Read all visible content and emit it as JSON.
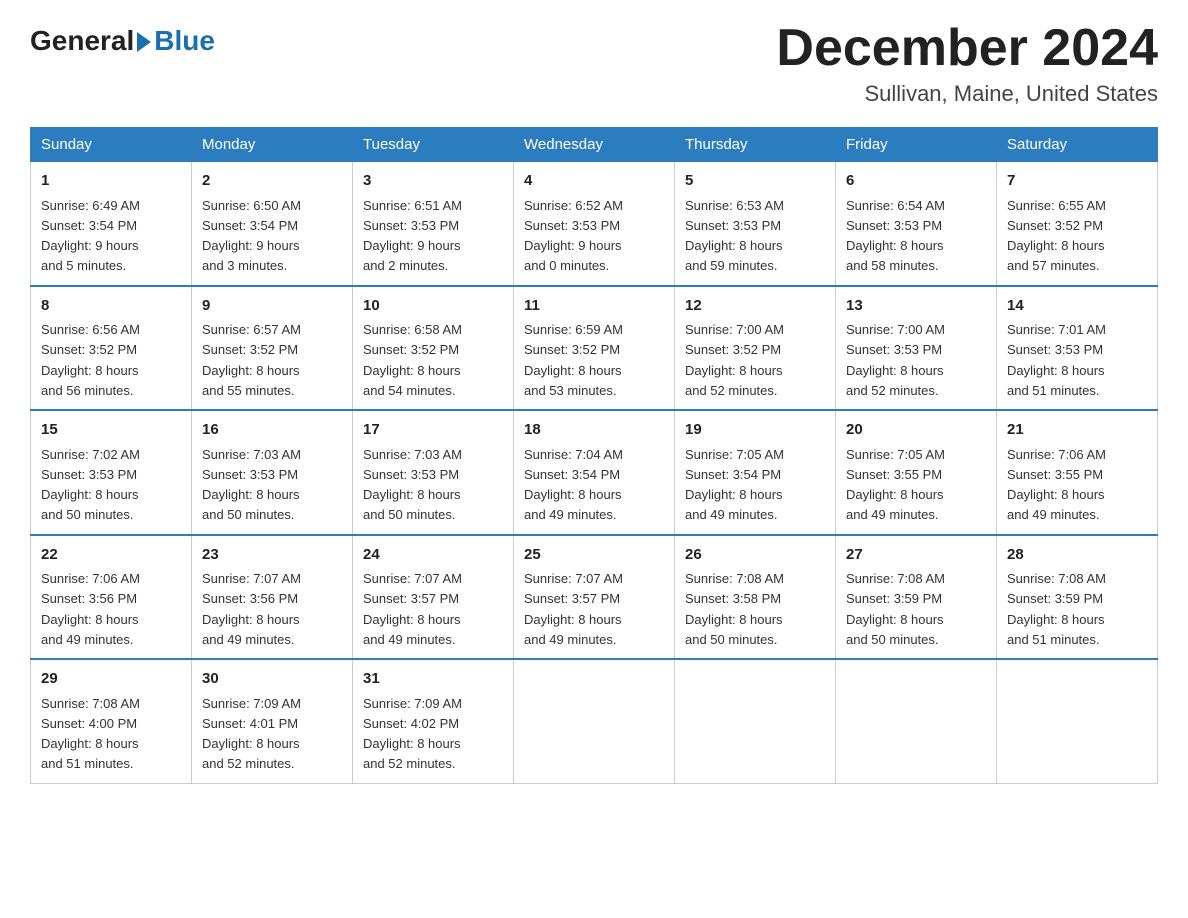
{
  "logo": {
    "general": "General",
    "blue": "Blue"
  },
  "header": {
    "month": "December 2024",
    "location": "Sullivan, Maine, United States"
  },
  "days_of_week": [
    "Sunday",
    "Monday",
    "Tuesday",
    "Wednesday",
    "Thursday",
    "Friday",
    "Saturday"
  ],
  "weeks": [
    [
      {
        "num": "1",
        "sunrise": "6:49 AM",
        "sunset": "3:54 PM",
        "daylight": "9 hours and 5 minutes."
      },
      {
        "num": "2",
        "sunrise": "6:50 AM",
        "sunset": "3:54 PM",
        "daylight": "9 hours and 3 minutes."
      },
      {
        "num": "3",
        "sunrise": "6:51 AM",
        "sunset": "3:53 PM",
        "daylight": "9 hours and 2 minutes."
      },
      {
        "num": "4",
        "sunrise": "6:52 AM",
        "sunset": "3:53 PM",
        "daylight": "9 hours and 0 minutes."
      },
      {
        "num": "5",
        "sunrise": "6:53 AM",
        "sunset": "3:53 PM",
        "daylight": "8 hours and 59 minutes."
      },
      {
        "num": "6",
        "sunrise": "6:54 AM",
        "sunset": "3:53 PM",
        "daylight": "8 hours and 58 minutes."
      },
      {
        "num": "7",
        "sunrise": "6:55 AM",
        "sunset": "3:52 PM",
        "daylight": "8 hours and 57 minutes."
      }
    ],
    [
      {
        "num": "8",
        "sunrise": "6:56 AM",
        "sunset": "3:52 PM",
        "daylight": "8 hours and 56 minutes."
      },
      {
        "num": "9",
        "sunrise": "6:57 AM",
        "sunset": "3:52 PM",
        "daylight": "8 hours and 55 minutes."
      },
      {
        "num": "10",
        "sunrise": "6:58 AM",
        "sunset": "3:52 PM",
        "daylight": "8 hours and 54 minutes."
      },
      {
        "num": "11",
        "sunrise": "6:59 AM",
        "sunset": "3:52 PM",
        "daylight": "8 hours and 53 minutes."
      },
      {
        "num": "12",
        "sunrise": "7:00 AM",
        "sunset": "3:52 PM",
        "daylight": "8 hours and 52 minutes."
      },
      {
        "num": "13",
        "sunrise": "7:00 AM",
        "sunset": "3:53 PM",
        "daylight": "8 hours and 52 minutes."
      },
      {
        "num": "14",
        "sunrise": "7:01 AM",
        "sunset": "3:53 PM",
        "daylight": "8 hours and 51 minutes."
      }
    ],
    [
      {
        "num": "15",
        "sunrise": "7:02 AM",
        "sunset": "3:53 PM",
        "daylight": "8 hours and 50 minutes."
      },
      {
        "num": "16",
        "sunrise": "7:03 AM",
        "sunset": "3:53 PM",
        "daylight": "8 hours and 50 minutes."
      },
      {
        "num": "17",
        "sunrise": "7:03 AM",
        "sunset": "3:53 PM",
        "daylight": "8 hours and 50 minutes."
      },
      {
        "num": "18",
        "sunrise": "7:04 AM",
        "sunset": "3:54 PM",
        "daylight": "8 hours and 49 minutes."
      },
      {
        "num": "19",
        "sunrise": "7:05 AM",
        "sunset": "3:54 PM",
        "daylight": "8 hours and 49 minutes."
      },
      {
        "num": "20",
        "sunrise": "7:05 AM",
        "sunset": "3:55 PM",
        "daylight": "8 hours and 49 minutes."
      },
      {
        "num": "21",
        "sunrise": "7:06 AM",
        "sunset": "3:55 PM",
        "daylight": "8 hours and 49 minutes."
      }
    ],
    [
      {
        "num": "22",
        "sunrise": "7:06 AM",
        "sunset": "3:56 PM",
        "daylight": "8 hours and 49 minutes."
      },
      {
        "num": "23",
        "sunrise": "7:07 AM",
        "sunset": "3:56 PM",
        "daylight": "8 hours and 49 minutes."
      },
      {
        "num": "24",
        "sunrise": "7:07 AM",
        "sunset": "3:57 PM",
        "daylight": "8 hours and 49 minutes."
      },
      {
        "num": "25",
        "sunrise": "7:07 AM",
        "sunset": "3:57 PM",
        "daylight": "8 hours and 49 minutes."
      },
      {
        "num": "26",
        "sunrise": "7:08 AM",
        "sunset": "3:58 PM",
        "daylight": "8 hours and 50 minutes."
      },
      {
        "num": "27",
        "sunrise": "7:08 AM",
        "sunset": "3:59 PM",
        "daylight": "8 hours and 50 minutes."
      },
      {
        "num": "28",
        "sunrise": "7:08 AM",
        "sunset": "3:59 PM",
        "daylight": "8 hours and 51 minutes."
      }
    ],
    [
      {
        "num": "29",
        "sunrise": "7:08 AM",
        "sunset": "4:00 PM",
        "daylight": "8 hours and 51 minutes."
      },
      {
        "num": "30",
        "sunrise": "7:09 AM",
        "sunset": "4:01 PM",
        "daylight": "8 hours and 52 minutes."
      },
      {
        "num": "31",
        "sunrise": "7:09 AM",
        "sunset": "4:02 PM",
        "daylight": "8 hours and 52 minutes."
      },
      null,
      null,
      null,
      null
    ]
  ],
  "labels": {
    "sunrise": "Sunrise:",
    "sunset": "Sunset:",
    "daylight": "Daylight:"
  }
}
